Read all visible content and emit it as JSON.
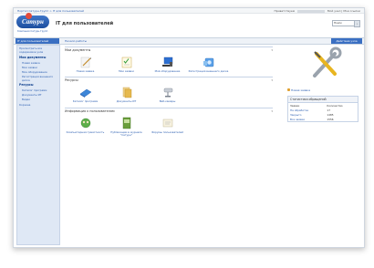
{
  "topbar": {
    "breadcrumb": "Портал Сатурн-Групп > IT для пользователей",
    "welcome": "Приветствуем",
    "my_site": "Мой узел",
    "my_links": "Мои ссылки"
  },
  "header": {
    "logo_text": "Сатурн",
    "logo_sub": "Компания Сатурн-Групп",
    "site_title": "IT для пользователей",
    "search_placeholder": "Поиск",
    "search_go": "›"
  },
  "nav": {
    "active_tab": "IT для пользователей",
    "link": "Начало работы",
    "right_action": "Действия узла"
  },
  "sidebar": {
    "top_link": "Просмотреть все содержимое узла",
    "sections": [
      {
        "title": "Мои документы",
        "items": [
          "Новая заявка",
          "Мои заявки",
          "Мое оборудование",
          "Регистрация внешнего диска"
        ]
      },
      {
        "title": "Ресурсы",
        "items": [
          "Каталог программ",
          "Документы ИТ",
          "Видео"
        ]
      }
    ],
    "trash": "Корзина"
  },
  "main": {
    "panels": [
      {
        "title": "Мои документы",
        "tiles": [
          {
            "label": "Новая заявка",
            "icon": "pen-document-icon"
          },
          {
            "label": "Мои заявки",
            "icon": "checklist-icon"
          },
          {
            "label": "Моё оборудование",
            "icon": "computer-icon"
          },
          {
            "label": "Регистрация внешнего диска",
            "icon": "disk-icon"
          }
        ]
      },
      {
        "title": "Ресурсы",
        "tiles": [
          {
            "label": "Каталог программ",
            "icon": "book-icon"
          },
          {
            "label": "Документы ИТ",
            "icon": "folder-icon"
          },
          {
            "label": "Веб-камеры",
            "icon": "camera-icon"
          }
        ]
      },
      {
        "title": "Информация к пользователям",
        "tiles": [
          {
            "label": "Компьютерная грамотность",
            "icon": "globe-people-icon"
          },
          {
            "label": "Публикации в журнале \"Сатурн\"",
            "icon": "magazine-icon"
          },
          {
            "label": "Форумы пользователей",
            "icon": "forum-icon"
          }
        ]
      }
    ]
  },
  "right": {
    "tools_icon": "wrench-screwdriver-icon",
    "new_page": "Новая заявка",
    "stats": {
      "title": "Статистика обращений",
      "columns": [
        "Заявки",
        "Количество"
      ],
      "rows": [
        {
          "name": "На обработке",
          "count": "17"
        },
        {
          "name": "Закрыто",
          "count": "1485"
        },
        {
          "name": "Все заявки",
          "count": "1556"
        }
      ]
    }
  },
  "colors": {
    "accent": "#3a6fc2",
    "link": "#2a5db0",
    "sidebar_bg": "#dfe8f5"
  }
}
